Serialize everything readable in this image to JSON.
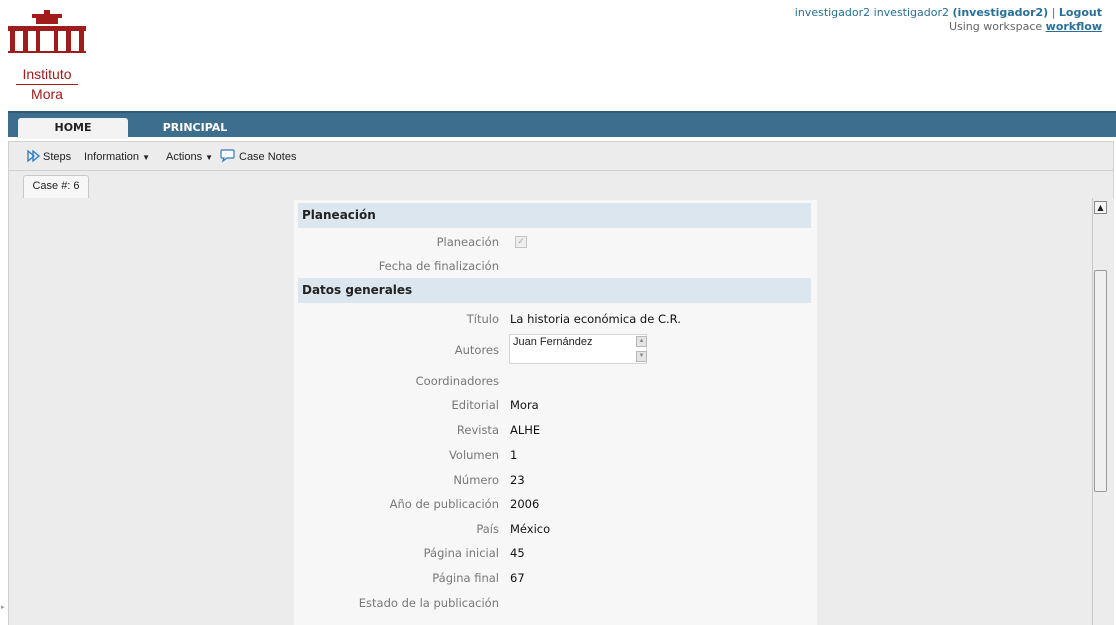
{
  "header": {
    "logo_line1": "Instituto",
    "logo_line2": "Mora",
    "user_display": "investigador2 investigador2",
    "username": "(investigador2)",
    "separator": "|",
    "logout": "Logout",
    "workspace_prefix": "Using workspace",
    "workspace_name": "workflow"
  },
  "nav": {
    "tabs": [
      {
        "label": "HOME"
      },
      {
        "label": "PRINCIPAL"
      }
    ]
  },
  "toolbar": {
    "steps": "Steps",
    "information": "Information",
    "actions": "Actions",
    "case_notes": "Case Notes"
  },
  "case_tab": "Case #: 6",
  "form": {
    "section_planeacion": "Planeación",
    "planeacion_label": "Planeación",
    "planeacion_checked": true,
    "fecha_label": "Fecha de finalización",
    "fecha_value": "",
    "section_datos": "Datos generales",
    "titulo_label": "Título",
    "titulo_value": "La historia económica de C.R.",
    "autores_label": "Autores",
    "autores_value": "Juan Fernández",
    "coordinadores_label": "Coordinadores",
    "coordinadores_value": "",
    "editorial_label": "Editorial",
    "editorial_value": "Mora",
    "revista_label": "Revista",
    "revista_value": "ALHE",
    "volumen_label": "Volumen",
    "volumen_value": "1",
    "numero_label": "Número",
    "numero_value": "23",
    "anio_label": "Año de publicación",
    "anio_value": "2006",
    "pais_label": "País",
    "pais_value": "México",
    "pagina_inicial_label": "Página inicial",
    "pagina_inicial_value": "45",
    "pagina_final_label": "Página final",
    "pagina_final_value": "67",
    "estado_label": "Estado de la publicación",
    "estado_value": ""
  },
  "colors": {
    "navbar": "#3d6e8e",
    "section_header": "#dce6ef",
    "logo_red": "#a01c1c",
    "link_blue": "#2a6f97"
  }
}
